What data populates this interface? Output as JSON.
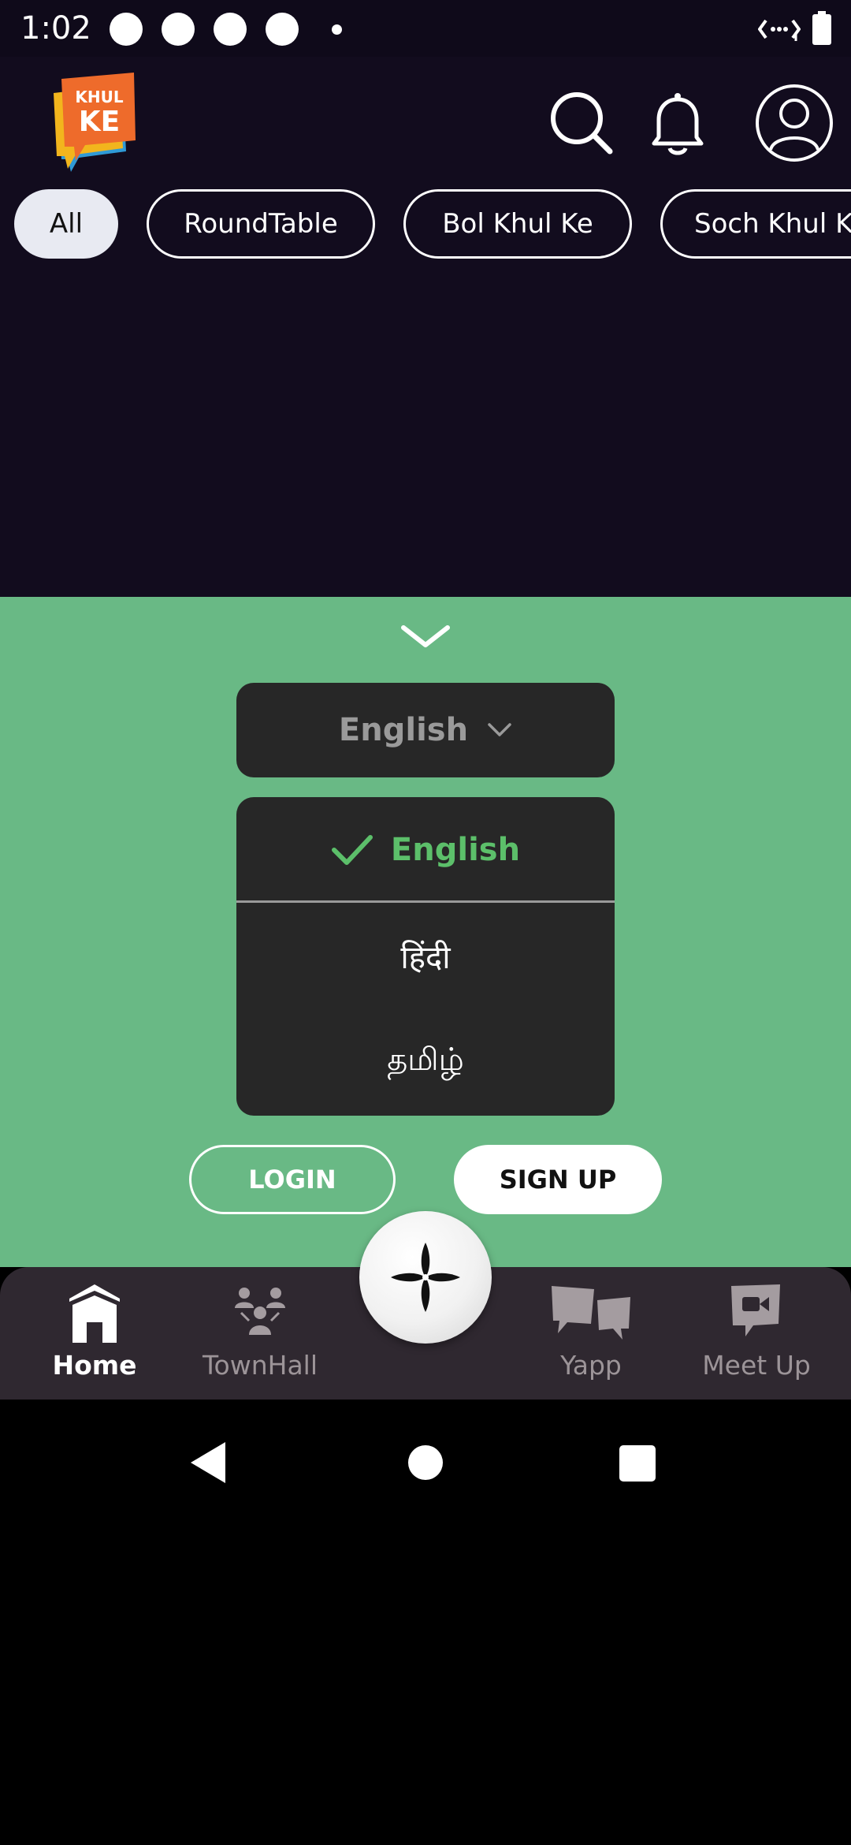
{
  "status_bar": {
    "time": "1:02"
  },
  "header": {
    "logo_text": "KHUL KE",
    "icons": [
      "search-icon",
      "bell-icon",
      "profile-icon"
    ]
  },
  "filters": {
    "chips": [
      "All",
      "RoundTable",
      "Bol Khul Ke",
      "Soch Khul K"
    ],
    "active": "All"
  },
  "language": {
    "selected": "English",
    "options": [
      "English",
      "हिंदी",
      "தமிழ்"
    ]
  },
  "auth": {
    "login_label": "LOGIN",
    "signup_label": "SIGN UP"
  },
  "bottom_nav": {
    "items": [
      {
        "label": "Home",
        "icon": "home-icon",
        "active": true
      },
      {
        "label": "TownHall",
        "icon": "people-icon",
        "active": false
      },
      {
        "label": "Yapp",
        "icon": "chat-bubbles-icon",
        "active": false
      },
      {
        "label": "Meet Up",
        "icon": "video-chat-icon",
        "active": false
      }
    ]
  },
  "colors": {
    "header_bg": "#120c1e",
    "sheet_bg": "#69b985",
    "panel_bg": "#272727",
    "accent_green": "#5cbf6a",
    "nav_bg": "#2f2830"
  }
}
